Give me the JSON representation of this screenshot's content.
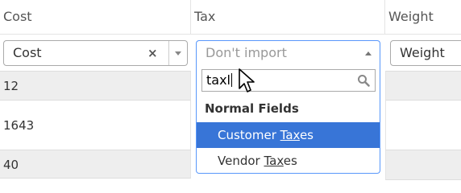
{
  "columns": [
    {
      "header": "Cost",
      "select_value": "Cost"
    },
    {
      "header": "Tax",
      "select_placeholder": "Don't import"
    },
    {
      "header": "Weight",
      "select_value": "Weight"
    }
  ],
  "rows": [
    {
      "cost": "12"
    },
    {
      "cost": "1643"
    },
    {
      "cost": "40"
    }
  ],
  "dropdown": {
    "search_text": "taxl",
    "group_label": "Normal Fields",
    "options": [
      {
        "pre": "Customer ",
        "match": "Tax",
        "post": "es",
        "highlighted": true
      },
      {
        "pre": "Vendor ",
        "match": "Tax",
        "post": "es",
        "highlighted": false
      }
    ]
  },
  "colors": {
    "highlight": "#3875d7",
    "focus_border": "#5897fb"
  }
}
